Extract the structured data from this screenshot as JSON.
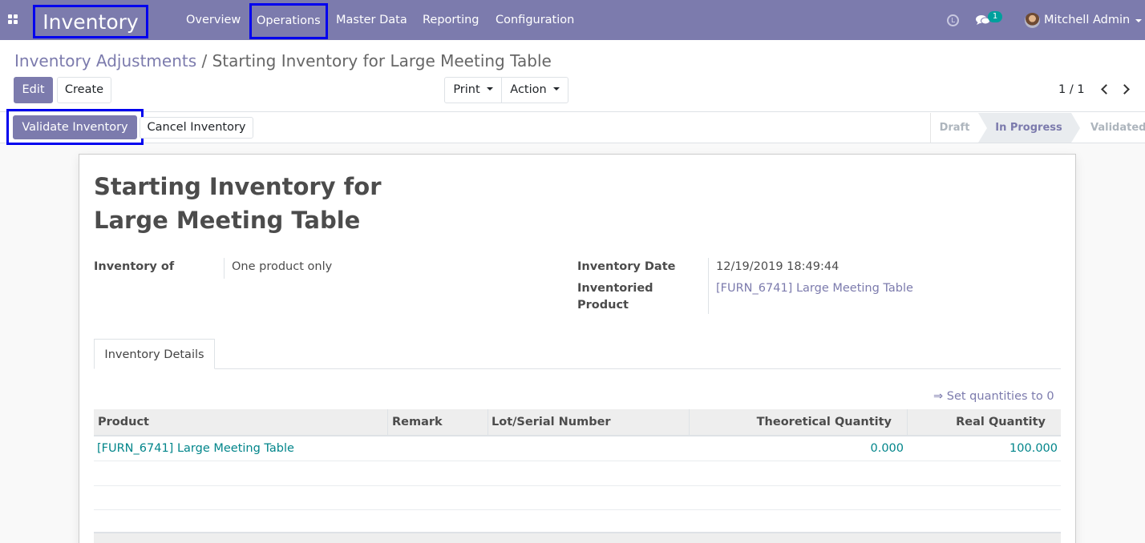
{
  "navbar": {
    "app_name": "Inventory",
    "menu": [
      "Overview",
      "Operations",
      "Master Data",
      "Reporting",
      "Configuration"
    ],
    "chat_count": "1",
    "user_name": "Mitchell Admin",
    "icons": [
      "apps-grid-icon",
      "clock-icon",
      "chat-icon",
      "user-avatar"
    ]
  },
  "breadcrumb": {
    "parent": "Inventory Adjustments",
    "separator": " / ",
    "current": "Starting Inventory for Large Meeting Table"
  },
  "buttons": {
    "edit": "Edit",
    "create": "Create",
    "print": "Print",
    "action": "Action",
    "validate": "Validate Inventory",
    "cancel": "Cancel Inventory"
  },
  "pager": {
    "value": "1 / 1"
  },
  "stages": [
    {
      "label": "Draft",
      "active": false
    },
    {
      "label": "In Progress",
      "active": true
    },
    {
      "label": "Validated",
      "active": false
    }
  ],
  "record": {
    "title_line1": "Starting Inventory for",
    "title_line2": "Large Meeting Table",
    "inventory_of_label": "Inventory of",
    "inventory_of_value": "One product only",
    "date_label": "Inventory Date",
    "date_value": "12/19/2019 18:49:44",
    "product_label_line1": "Inventoried",
    "product_label_line2": "Product",
    "product_value": "[FURN_6741] Large Meeting Table"
  },
  "tab": {
    "label": "Inventory Details"
  },
  "set_quantities": "⇒ Set quantities to 0",
  "table": {
    "columns": [
      "Product",
      "Remark",
      "Lot/Serial Number",
      "Theoretical Quantity",
      "Real Quantity"
    ],
    "rows": [
      {
        "product": "[FURN_6741] Large Meeting Table",
        "remark": "",
        "lot": "",
        "theoretical": "0.000",
        "real": "100.000"
      }
    ]
  },
  "colors": {
    "brand": "#7c7bad",
    "link": "#01858a",
    "highlight_box": "#0000ee",
    "badge": "#00a09d"
  }
}
